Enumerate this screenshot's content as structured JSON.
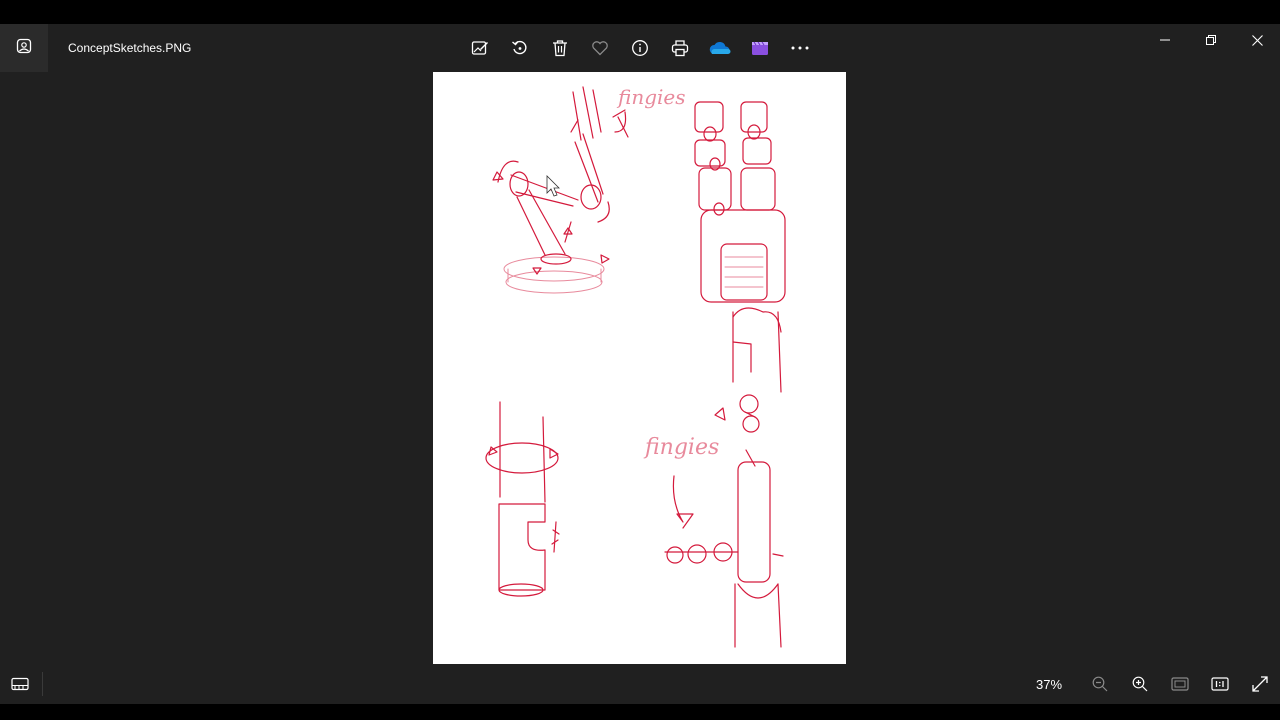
{
  "window": {
    "filename": "ConceptSketches.PNG"
  },
  "toolbar": [
    {
      "name": "edit-image-icon"
    },
    {
      "name": "rotate-icon"
    },
    {
      "name": "delete-icon"
    },
    {
      "name": "favorite-heart-icon"
    },
    {
      "name": "file-info-icon"
    },
    {
      "name": "print-icon"
    },
    {
      "name": "onedrive-cloud-icon"
    },
    {
      "name": "video-editor-icon"
    },
    {
      "name": "more-options-icon"
    }
  ],
  "image": {
    "annotation_top": "fingies",
    "annotation_bottom": "fingies"
  },
  "bottombar": {
    "zoom": "37%"
  },
  "colors": {
    "background": "#202020",
    "sketch_ink": "#d41a3c",
    "onedrive": "#0f78d4",
    "video_editor": "#8a4fe0"
  }
}
